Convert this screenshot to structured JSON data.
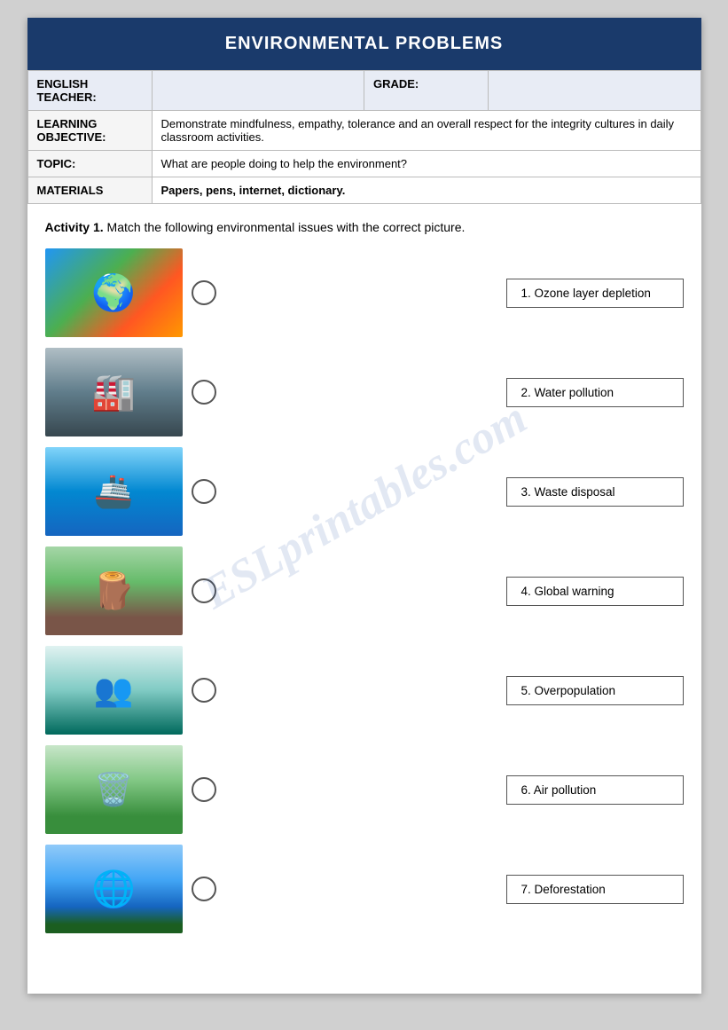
{
  "header": {
    "title": "ENVIRONMENTAL PROBLEMS"
  },
  "infoTable": {
    "teacherLabel": "ENGLISH TEACHER:",
    "gradeLabel": "GRADE:",
    "learningLabel": "LEARNING OBJECTIVE:",
    "learningValue": "Demonstrate mindfulness, empathy, tolerance and an overall respect for the integrity cultures in daily classroom activities.",
    "topicLabel": "TOPIC:",
    "topicValue": "What are people doing to help the environment?",
    "materialsLabel": "MATERIALS",
    "materialsValue": "Papers, pens, internet, dictionary."
  },
  "activity": {
    "title": "Activity 1.",
    "instruction": "Match the following environmental issues with the correct picture.",
    "items": [
      {
        "id": 1,
        "label": "1. Ozone layer depletion"
      },
      {
        "id": 2,
        "label": "2. Water pollution"
      },
      {
        "id": 3,
        "label": "3. Waste disposal"
      },
      {
        "id": 4,
        "label": "4. Global warning"
      },
      {
        "id": 5,
        "label": "5. Overpopulation"
      },
      {
        "id": 6,
        "label": "6. Air pollution"
      },
      {
        "id": 7,
        "label": "7. Deforestation"
      }
    ]
  },
  "watermark": "ESLprintables.com"
}
